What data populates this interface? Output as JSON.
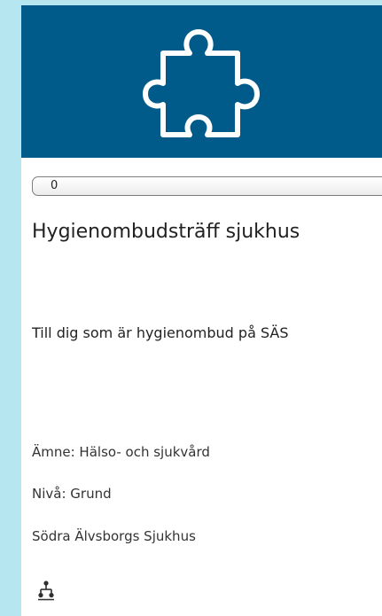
{
  "hero": {
    "icon": "puzzle-piece-icon",
    "background": "#005b8b"
  },
  "progress": {
    "value_text": "0",
    "fraction": 0
  },
  "course": {
    "title": "Hygienombudsträff sjukhus",
    "intro": "Till dig som är hygienombud på SÄS"
  },
  "meta": {
    "subject": "Ämne: Hälso- och sjukvård",
    "level": "Nivå: Grund",
    "organization": "Södra Älvsborgs Sjukhus"
  },
  "footer": {
    "icon": "network-icon"
  }
}
